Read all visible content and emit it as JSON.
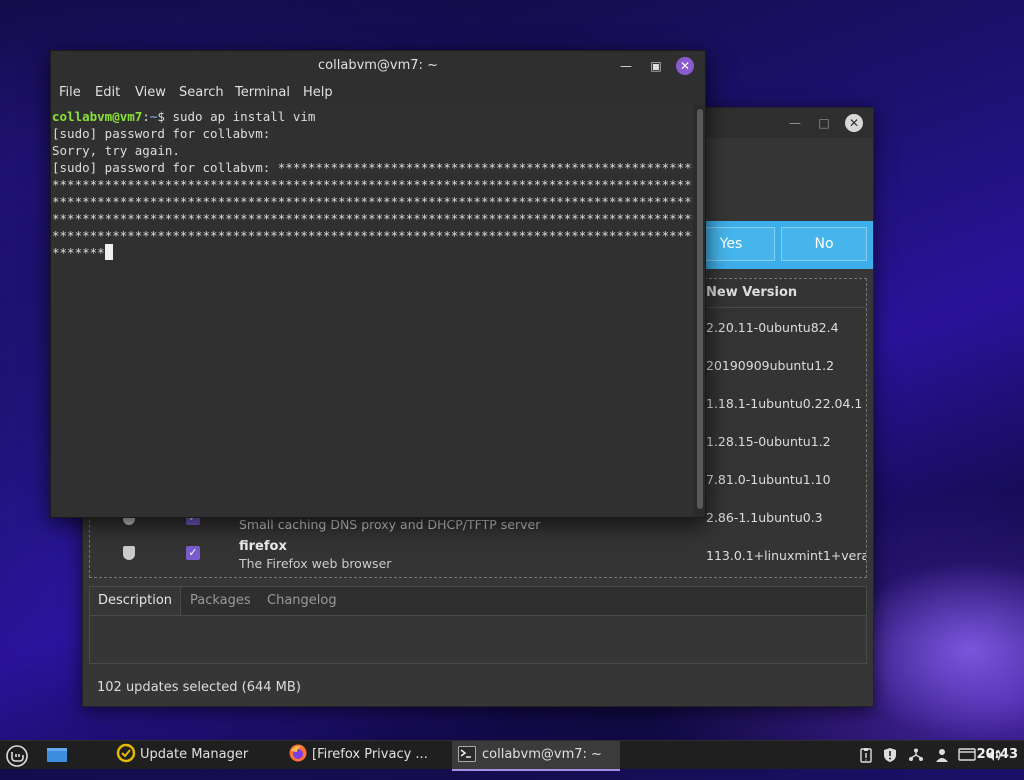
{
  "update_manager": {
    "buttons": {
      "yes": "Yes",
      "no": "No"
    },
    "column_new_version": "New Version",
    "versions": [
      "2.20.11-0ubuntu82.4",
      "20190909ubuntu1.2",
      "1.18.1-1ubuntu0.22.04.1",
      "1.28.15-0ubuntu1.2",
      "7.81.0-1ubuntu1.10",
      "2.86-1.1ubuntu0.3",
      "113.0.1+linuxmint1+vera"
    ],
    "rows": [
      {
        "name": "",
        "description": "Small caching DNS proxy and DHCP/TFTP server"
      },
      {
        "name": "firefox",
        "description": "The Firefox web browser"
      }
    ],
    "tabs": [
      "Description",
      "Packages",
      "Changelog"
    ],
    "status": "102 updates selected (644 MB)"
  },
  "terminal": {
    "title": "collabvm@vm7: ~",
    "menu": [
      "File",
      "Edit",
      "View",
      "Search",
      "Terminal",
      "Help"
    ],
    "prompt_user": "collabvm@vm7",
    "prompt_sep": ":",
    "prompt_path": "~",
    "prompt_end": "$ ",
    "command": "sudo ap install vim",
    "lines": [
      "[sudo] password for collabvm:",
      "Sorry, try again.",
      "[sudo] password for collabvm: *********************************************************",
      "****************************************************************************************",
      "****************************************************************************************",
      "****************************************************************************************",
      "****************************************************************************************",
      "*******"
    ]
  },
  "taskbar": {
    "items": [
      {
        "label": "Update Manager",
        "icon": "update-manager-icon"
      },
      {
        "label": "[Firefox Privacy ...",
        "icon": "firefox-icon"
      },
      {
        "label": "collabvm@vm7: ~",
        "icon": "terminal-icon"
      }
    ],
    "clock": "20:43"
  }
}
